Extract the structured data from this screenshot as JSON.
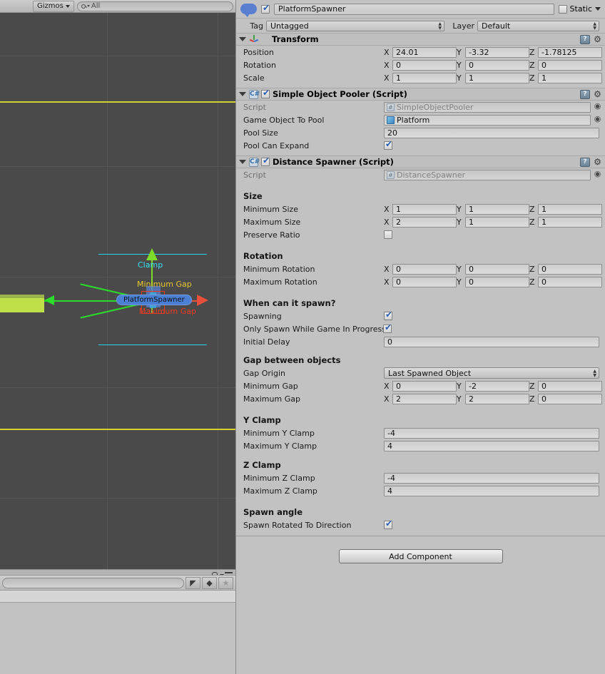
{
  "scene": {
    "toolbar": {
      "gizmos_label": "Gizmos",
      "search_value": "All",
      "search_icon": "search-icon",
      "dropdown_icon": "chevron-down-icon"
    },
    "gizmo_labels": {
      "clamp": "Clamp",
      "minimum_gap": "Minimum Gap",
      "maximum_gap": "Maximum Gap",
      "object_name": "PlatformSpawner"
    },
    "colors": {
      "background": "#4a4a4a",
      "grid": "#565656",
      "clamp_line": "#23d5e6",
      "yellow_line": "#d2d233",
      "gap_min_text": "#e8c62c",
      "gap_max_text": "#f03a1e",
      "x_axis": "#e8503c",
      "y_axis": "#7ddb2a",
      "platform": "#c0e04a"
    }
  },
  "project_panel": {
    "lock_icon": "lock-icon",
    "menu_icon": "hamburger-menu-icon",
    "search_placeholder": "",
    "search_value": "",
    "filters": [
      {
        "name": "filter-by-type",
        "glyph": "◤"
      },
      {
        "name": "filter-by-label",
        "glyph": "◆"
      },
      {
        "name": "filter-favorites",
        "glyph": "★"
      }
    ]
  },
  "inspector": {
    "object": {
      "icon": "gameobject-icon",
      "enabled": true,
      "name": "PlatformSpawner",
      "static_label": "Static",
      "static_checked": false,
      "tag_label": "Tag",
      "tag_value": "Untagged",
      "layer_label": "Layer",
      "layer_value": "Default"
    },
    "components": [
      {
        "id": "transform",
        "title": "Transform",
        "icon": "transform-axis-icon",
        "has_enable_checkbox": false,
        "expanded": true,
        "rows": [
          {
            "type": "vec3",
            "label": "Position",
            "x": "24.01",
            "y": "-3.32",
            "z": "-1.78125"
          },
          {
            "type": "vec3",
            "label": "Rotation",
            "x": "0",
            "y": "0",
            "z": "0"
          },
          {
            "type": "vec3",
            "label": "Scale",
            "x": "1",
            "y": "1",
            "z": "1"
          }
        ]
      },
      {
        "id": "simple-object-pooler",
        "title": "Simple Object Pooler (Script)",
        "icon": "csharp-script-icon",
        "has_enable_checkbox": true,
        "enabled": true,
        "expanded": true,
        "rows": [
          {
            "type": "object",
            "label": "Script",
            "value": "SimpleObjectPooler",
            "dim": true,
            "icon": "script-asset-icon"
          },
          {
            "type": "object",
            "label": "Game Object To Pool",
            "value": "Platform",
            "dim": false,
            "icon": "prefab-cube-icon"
          },
          {
            "type": "text",
            "label": "Pool Size",
            "value": "20"
          },
          {
            "type": "checkbox",
            "label": "Pool Can Expand",
            "checked": true
          }
        ]
      },
      {
        "id": "distance-spawner",
        "title": "Distance Spawner (Script)",
        "icon": "csharp-script-icon",
        "has_enable_checkbox": true,
        "enabled": true,
        "expanded": true,
        "rows": [
          {
            "type": "object",
            "label": "Script",
            "value": "DistanceSpawner",
            "dim": true,
            "icon": "script-asset-icon"
          },
          {
            "type": "spacer"
          },
          {
            "type": "header",
            "label": "Size"
          },
          {
            "type": "vec3",
            "label": "Minimum Size",
            "x": "1",
            "y": "1",
            "z": "1"
          },
          {
            "type": "vec3",
            "label": "Maximum Size",
            "x": "2",
            "y": "1",
            "z": "1"
          },
          {
            "type": "checkbox",
            "label": "Preserve Ratio",
            "checked": false
          },
          {
            "type": "spacer"
          },
          {
            "type": "header",
            "label": "Rotation"
          },
          {
            "type": "vec3",
            "label": "Minimum Rotation",
            "x": "0",
            "y": "0",
            "z": "0"
          },
          {
            "type": "vec3",
            "label": "Maximum Rotation",
            "x": "0",
            "y": "0",
            "z": "0"
          },
          {
            "type": "spacer"
          },
          {
            "type": "header",
            "label": "When can it spawn?"
          },
          {
            "type": "checkbox",
            "label": "Spawning",
            "checked": true
          },
          {
            "type": "checkbox",
            "label": "Only Spawn While Game In Progress",
            "checked": true,
            "truncated": true
          },
          {
            "type": "text",
            "label": "Initial Delay",
            "value": "0"
          },
          {
            "type": "spacer"
          },
          {
            "type": "header",
            "label": "Gap between objects"
          },
          {
            "type": "dropdown",
            "label": "Gap Origin",
            "value": "Last Spawned Object"
          },
          {
            "type": "vec3",
            "label": "Minimum Gap",
            "x": "0",
            "y": "-2",
            "z": "0"
          },
          {
            "type": "vec3",
            "label": "Maximum Gap",
            "x": "2",
            "y": "2",
            "z": "0"
          },
          {
            "type": "spacer"
          },
          {
            "type": "header",
            "label": "Y Clamp"
          },
          {
            "type": "text",
            "label": "Minimum Y Clamp",
            "value": "-4"
          },
          {
            "type": "text",
            "label": "Maximum Y Clamp",
            "value": "4"
          },
          {
            "type": "spacer_small"
          },
          {
            "type": "header",
            "label": "Z Clamp"
          },
          {
            "type": "text",
            "label": "Minimum Z Clamp",
            "value": "-4"
          },
          {
            "type": "text",
            "label": "Maximum Z Clamp",
            "value": "4"
          },
          {
            "type": "spacer"
          },
          {
            "type": "header",
            "label": "Spawn angle"
          },
          {
            "type": "checkbox",
            "label": "Spawn Rotated To Direction",
            "checked": true
          }
        ]
      }
    ],
    "add_component_label": "Add Component",
    "help_icon": "help-book-icon",
    "gear_icon": "gear-icon"
  }
}
